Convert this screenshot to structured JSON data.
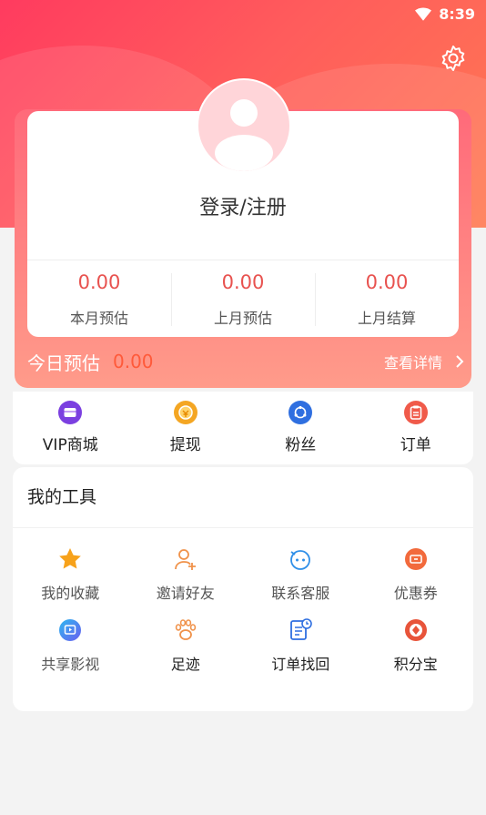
{
  "status_bar": {
    "time": "8:39"
  },
  "profile": {
    "login_label": "登录/注册"
  },
  "stats": [
    {
      "value": "0.00",
      "label": "本月预估"
    },
    {
      "value": "0.00",
      "label": "上月预估"
    },
    {
      "value": "0.00",
      "label": "上月结算"
    }
  ],
  "today": {
    "label": "今日预估",
    "value": "0.00",
    "detail_label": "查看详情"
  },
  "quick_actions": [
    {
      "label": "VIP商城",
      "icon": "vip-mall-icon"
    },
    {
      "label": "提现",
      "icon": "withdraw-icon"
    },
    {
      "label": "粉丝",
      "icon": "fans-icon"
    },
    {
      "label": "订单",
      "icon": "order-icon"
    }
  ],
  "tools": {
    "title": "我的工具",
    "items": [
      {
        "label": "我的收藏",
        "icon": "star-icon"
      },
      {
        "label": "邀请好友",
        "icon": "invite-friend-icon"
      },
      {
        "label": "联系客服",
        "icon": "customer-service-icon"
      },
      {
        "label": "优惠券",
        "icon": "coupon-icon"
      },
      {
        "label": "共享影视",
        "icon": "video-share-icon"
      },
      {
        "label": "足迹",
        "icon": "footprint-icon"
      },
      {
        "label": "订单找回",
        "icon": "order-retrieve-icon"
      },
      {
        "label": "积分宝",
        "icon": "points-treasure-icon"
      }
    ]
  },
  "colors": {
    "hero_gradient_start": "#ff3b5f",
    "hero_gradient_end": "#ff7a52",
    "stat_value": "#e8524f",
    "today_value": "#ff5a3a"
  }
}
